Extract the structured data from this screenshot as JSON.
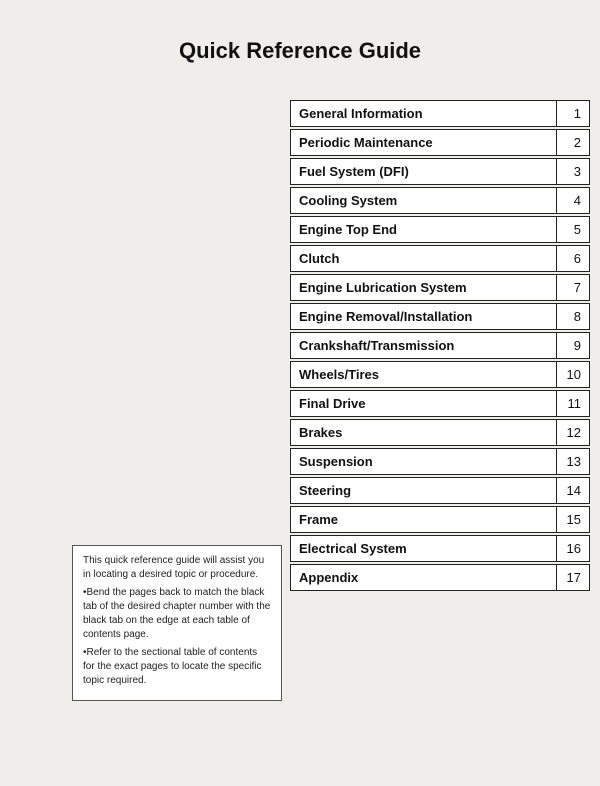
{
  "title": "Quick Reference Guide",
  "toc": {
    "items": [
      {
        "label": "General Information",
        "number": "1"
      },
      {
        "label": "Periodic Maintenance",
        "number": "2"
      },
      {
        "label": "Fuel System (DFI)",
        "number": "3"
      },
      {
        "label": "Cooling System",
        "number": "4"
      },
      {
        "label": "Engine Top End",
        "number": "5"
      },
      {
        "label": "Clutch",
        "number": "6"
      },
      {
        "label": "Engine Lubrication System",
        "number": "7"
      },
      {
        "label": "Engine Removal/Installation",
        "number": "8"
      },
      {
        "label": "Crankshaft/Transmission",
        "number": "9"
      },
      {
        "label": "Wheels/Tires",
        "number": "10"
      },
      {
        "label": "Final Drive",
        "number": "11"
      },
      {
        "label": "Brakes",
        "number": "12"
      },
      {
        "label": "Suspension",
        "number": "13"
      },
      {
        "label": "Steering",
        "number": "14"
      },
      {
        "label": "Frame",
        "number": "15"
      },
      {
        "label": "Electrical System",
        "number": "16"
      },
      {
        "label": "Appendix",
        "number": "17"
      }
    ]
  },
  "note": {
    "line1": "This quick reference guide will assist you in locating a desired topic or procedure.",
    "line2": "•Bend the pages back to match the black tab of the desired chapter number with the black tab on the edge at each table of contents page.",
    "line3": "•Refer to the sectional table of contents for the exact pages to locate the specific topic required."
  }
}
